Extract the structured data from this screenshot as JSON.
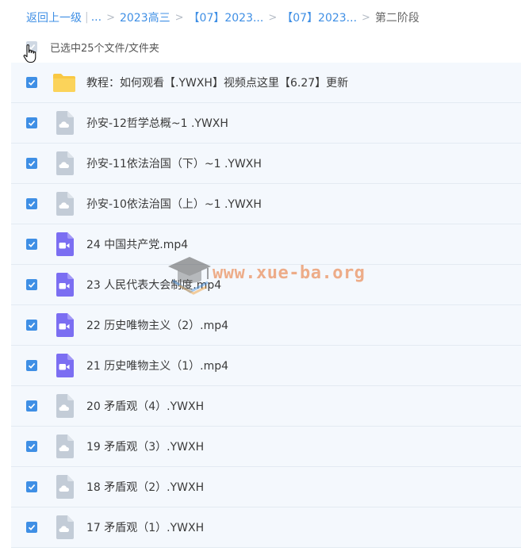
{
  "breadcrumb": {
    "back": "返回上一级",
    "ellipsis": "...",
    "items": [
      "2023高三",
      "【07】2023...",
      "【07】2023..."
    ],
    "current": "第二阶段"
  },
  "selection": {
    "label": "已选中25个文件/文件夹"
  },
  "files": [
    {
      "name": "教程：如何观看【.YWXH】视频点这里【6.27】更新",
      "icon": "folder-icon",
      "checked": true
    },
    {
      "name": "孙安-12哲学总概~1 .YWXH",
      "icon": "cloud-file-icon",
      "checked": true
    },
    {
      "name": "孙安-11依法治国（下）~1 .YWXH",
      "icon": "cloud-file-icon",
      "checked": true
    },
    {
      "name": "孙安-10依法治国（上）~1 .YWXH",
      "icon": "cloud-file-icon",
      "checked": true
    },
    {
      "name": "24 中国共产党.mp4",
      "icon": "video-file-icon",
      "checked": true
    },
    {
      "name": "23 人民代表大会制度.mp4",
      "icon": "video-file-icon",
      "checked": true
    },
    {
      "name": "22 历史唯物主义（2）.mp4",
      "icon": "video-file-icon",
      "checked": true
    },
    {
      "name": "21 历史唯物主义（1）.mp4",
      "icon": "video-file-icon",
      "checked": true
    },
    {
      "name": "20 矛盾观（4）.YWXH",
      "icon": "cloud-file-icon",
      "checked": true
    },
    {
      "name": "19 矛盾观（3）.YWXH",
      "icon": "cloud-file-icon",
      "checked": true
    },
    {
      "name": "18 矛盾观（2）.YWXH",
      "icon": "cloud-file-icon",
      "checked": true
    },
    {
      "name": "17 矛盾观（1）.YWXH",
      "icon": "cloud-file-icon",
      "checked": true
    }
  ],
  "watermark": {
    "text": "www.xue-ba.org"
  },
  "colors": {
    "accent": "#3f8fe5",
    "row_bg": "#f4f8fd",
    "folder": "#f9c843",
    "video": "#7b6ef2",
    "cloud_file": "#c3ccd7"
  }
}
